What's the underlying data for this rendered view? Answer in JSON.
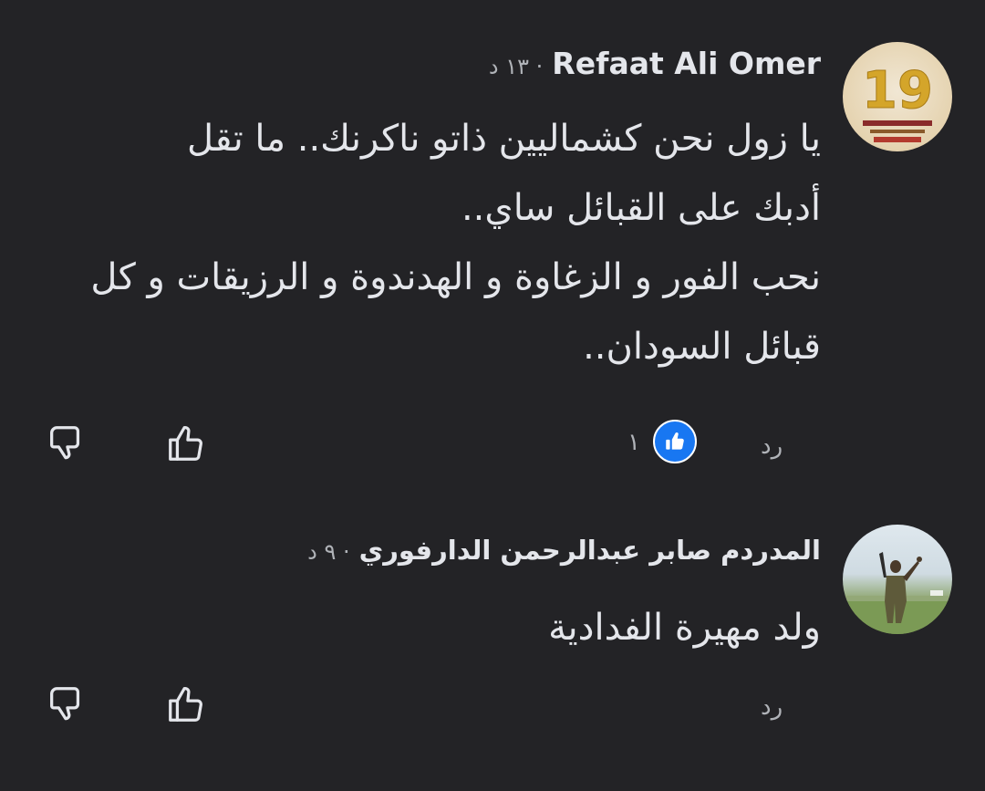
{
  "comments": [
    {
      "author": "Refaat Ali Omer",
      "time": "· ١٣ د",
      "text": "يا زول نحن كشماليين ذاتو ناكرنك.. ما تقل\nأدبك على القبائل ساي..\nنحب الفور و الزغاوة و الهدندوة و الرزيقات و كل\nقبائل السودان..",
      "reply_label": "رد",
      "reaction_count": "١",
      "avatar_icon": "number-19-logo-avatar",
      "avatar_text": "19"
    },
    {
      "author": "المدردم صابر عبدالرحمن الدارفوري",
      "time": "· ٩ د",
      "text": "ولد مهيرة الفدادية",
      "reply_label": "رد",
      "avatar_icon": "soldier-photo-avatar"
    }
  ],
  "colors": {
    "background": "#232326",
    "text": "#e4e6eb",
    "secondary": "#b0b3b8",
    "like_blue": "#1877f2"
  }
}
